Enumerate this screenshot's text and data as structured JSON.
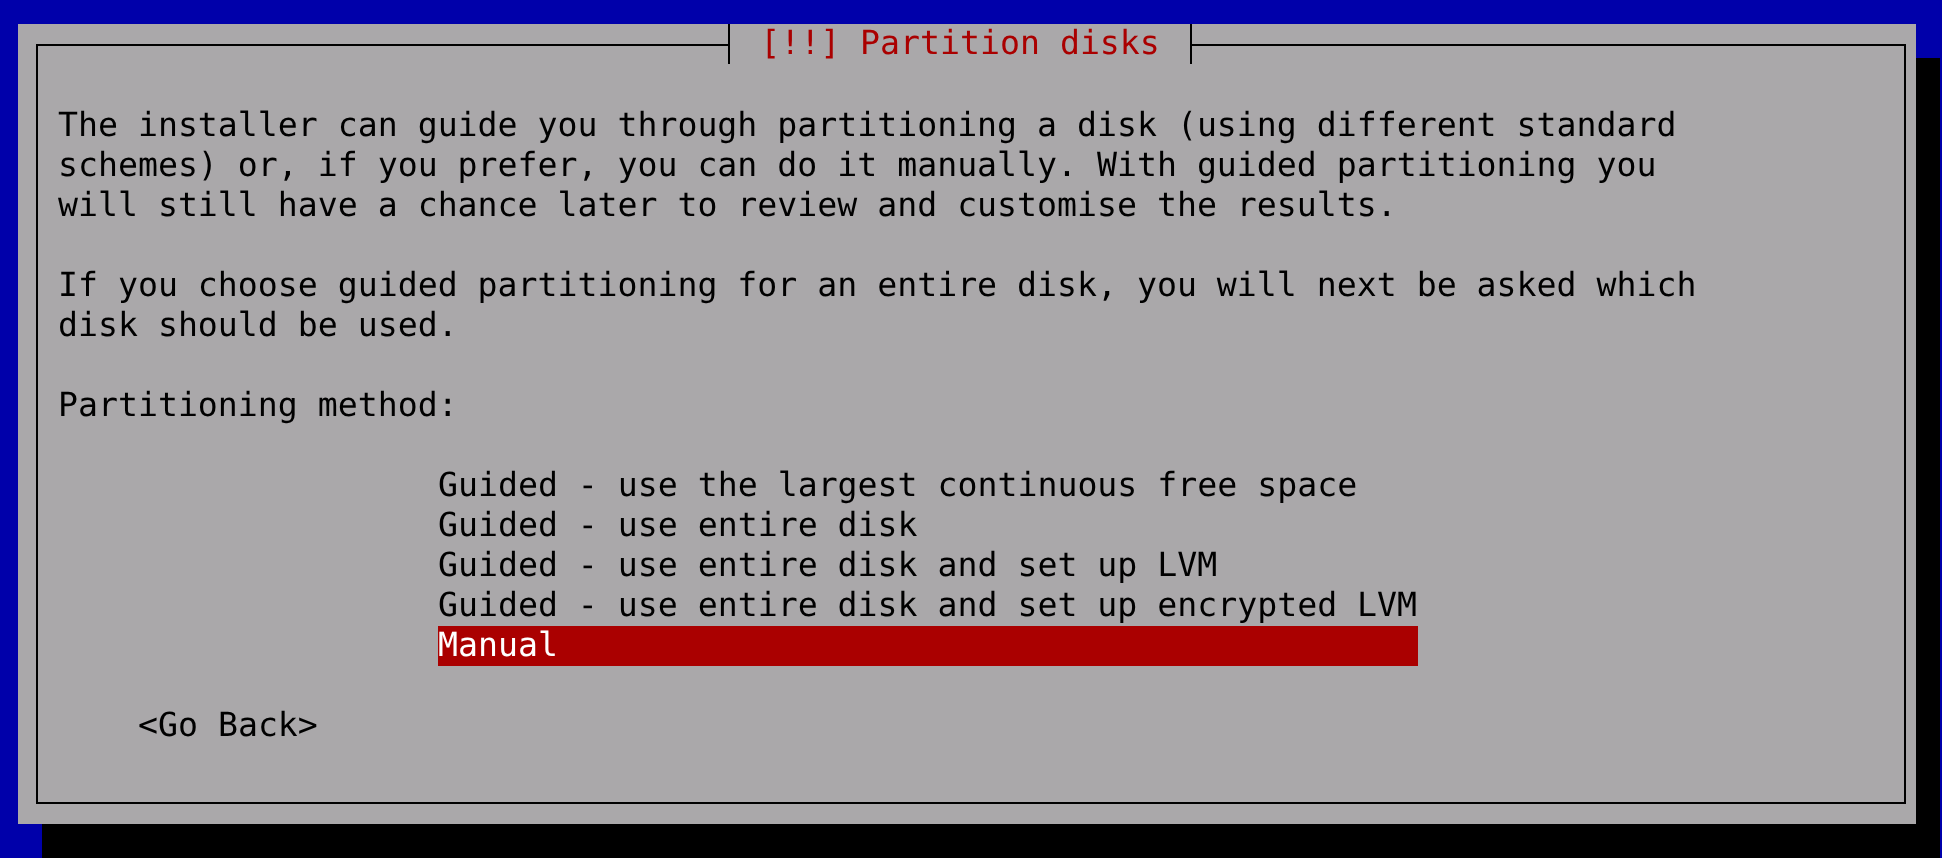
{
  "dialog": {
    "title": "[!!] Partition disks",
    "paragraphs": [
      "The installer can guide you through partitioning a disk (using different standard schemes) or, if you prefer, you can do it manually. With guided partitioning you will still have a chance later to review and customise the results.",
      "If you choose guided partitioning for an entire disk, you will next be asked which disk should be used."
    ],
    "prompt": "Partitioning method:",
    "options": [
      {
        "label": "Guided - use the largest continuous free space",
        "selected": false
      },
      {
        "label": "Guided - use entire disk",
        "selected": false
      },
      {
        "label": "Guided - use entire disk and set up LVM",
        "selected": false
      },
      {
        "label": "Guided - use entire disk and set up encrypted LVM",
        "selected": false
      },
      {
        "label": "Manual",
        "selected": true
      }
    ],
    "back_button": "<Go Back>"
  }
}
